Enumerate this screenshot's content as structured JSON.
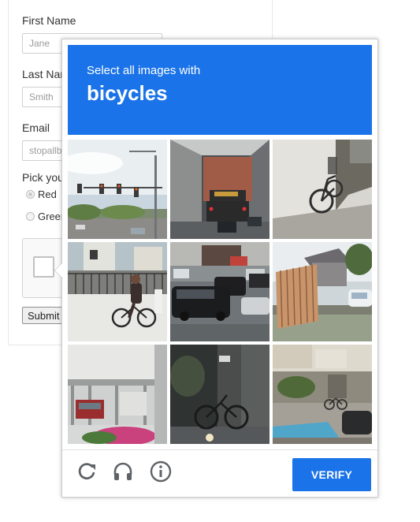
{
  "form": {
    "first_name_label": "First Name",
    "first_name_placeholder": "Jane",
    "last_name_label": "Last Nar",
    "last_name_placeholder": "Smith",
    "email_label": "Email",
    "email_placeholder": "stopallb",
    "pick_label": "Pick you",
    "radio_options": [
      "Red",
      "Green"
    ],
    "submit_label": "Submit"
  },
  "challenge": {
    "prompt_line1": "Select all images with",
    "prompt_target": "bicycles",
    "verify_label": "VERIFY",
    "tiles": [
      "street-traffic-lights",
      "vehicle-tunnel",
      "bicycle-against-wall",
      "cyclist-on-sidewalk",
      "cars-on-road",
      "wooden-fence-sign",
      "bus-stop-shelter",
      "bicycle-parked-night",
      "building-with-bike"
    ],
    "footer_icons": [
      "reload-icon",
      "audio-headphones-icon",
      "info-icon"
    ]
  },
  "colors": {
    "accent": "#1a73e8"
  }
}
